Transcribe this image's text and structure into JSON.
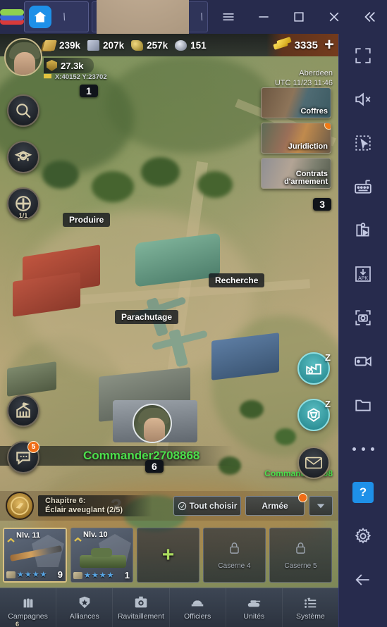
{
  "window": {
    "logo": "bluestacks-logo",
    "tabs": [
      {
        "id": "home",
        "icon": "home-icon",
        "close": "\\"
      },
      {
        "id": "game",
        "icon": "game-thumbnail",
        "close": "\\"
      }
    ],
    "controls": {
      "menu": "hamburger-menu-icon",
      "minimize": "minimize-icon",
      "maximize": "maximize-icon",
      "close": "close-icon",
      "collapse": "collapse-icon"
    }
  },
  "game": {
    "resources": [
      {
        "id": "food",
        "icon": "food-icon",
        "value": "239k"
      },
      {
        "id": "steel",
        "icon": "steel-icon",
        "value": "207k"
      },
      {
        "id": "oil",
        "icon": "oil-icon",
        "value": "257k"
      },
      {
        "id": "gem",
        "icon": "gem-icon",
        "value": "151"
      }
    ],
    "gold": {
      "icon": "gold-bars-icon",
      "value": "3335",
      "add": "+"
    },
    "player": {
      "avatar": "player-avatar",
      "level": "6",
      "power_icon": "power-badge-icon",
      "power": "27.3k",
      "flag_icon": "flag-icon",
      "coords": "X:40152 Y:23702"
    },
    "server": {
      "name": "Aberdeen",
      "time": "UTC  11/23 11:46"
    },
    "left_buttons": [
      {
        "id": "search",
        "icon": "search-icon",
        "count": ""
      },
      {
        "id": "rank",
        "icon": "rank-badge-icon",
        "count": ""
      },
      {
        "id": "aircraft",
        "icon": "aircraft-icon",
        "count": "1/1"
      }
    ],
    "left_bottom_buttons": [
      {
        "id": "base",
        "icon": "base-building-icon",
        "badge": ""
      },
      {
        "id": "chat",
        "icon": "chat-bubble-icon",
        "badge": "5"
      }
    ],
    "event_cards": [
      {
        "id": "chests",
        "label": "Coffres",
        "dot": false
      },
      {
        "id": "jurisdiction",
        "label": "Juridiction",
        "dot": true
      },
      {
        "id": "arms_contracts",
        "label": "Contrats\nd'armement",
        "dot": false
      }
    ],
    "event_count_badge": "3",
    "map_markers": [
      {
        "id": "marker-1",
        "value": "1"
      },
      {
        "id": "marker-6",
        "value": "6"
      }
    ],
    "map_labels": [
      {
        "id": "produce",
        "label": "Produire"
      },
      {
        "id": "research",
        "label": "Recherche"
      },
      {
        "id": "parachute",
        "label": "Parachutage"
      }
    ],
    "commander": {
      "name": "Commander2708868",
      "name_secondary": "Commander2708",
      "color": "#4ce04c"
    },
    "right_buttons": [
      {
        "id": "workshop",
        "icon": "factory-gear-icon",
        "badge": "Z"
      },
      {
        "id": "idle",
        "icon": "shield-hex-icon",
        "badge": "Z"
      },
      {
        "id": "mail",
        "icon": "mail-envelope-icon",
        "badge": ""
      }
    ],
    "quest": {
      "medal_icon": "quest-medal-icon",
      "chapter": "Chapitre 6:",
      "title": "Éclair aveuglant (2/5)",
      "choose_all": "Tout choisir",
      "choose_icon": "check-circle-icon",
      "army": "Armée",
      "army_dot": true,
      "caret_icon": "chevron-down-icon"
    },
    "cards": [
      {
        "id": "card-rifle",
        "level": "Nlv. 11",
        "stars": 4,
        "qty": "9",
        "state": "selected",
        "unit": "rifle"
      },
      {
        "id": "card-tank",
        "level": "Nlv. 10",
        "stars": 4,
        "qty": "1",
        "state": "normal",
        "unit": "tank"
      },
      {
        "id": "card-add",
        "level": "",
        "stars": 0,
        "qty": "",
        "state": "empty",
        "unit": "",
        "plus": "+"
      },
      {
        "id": "card-barracks-4",
        "level": "",
        "stars": 0,
        "qty": "",
        "state": "locked",
        "name": "Caserne 4",
        "lock_icon": "lock-icon"
      },
      {
        "id": "card-barracks-5",
        "level": "",
        "stars": 0,
        "qty": "",
        "state": "locked",
        "name": "Caserne 5",
        "lock_icon": "lock-icon"
      }
    ],
    "bottom_nav": [
      {
        "id": "campaigns",
        "label": "Campagnes",
        "icon": "bullets-icon"
      },
      {
        "id": "alliances",
        "label": "Alliances",
        "icon": "shield-star-icon"
      },
      {
        "id": "supplies",
        "label": "Ravitaillement",
        "icon": "supply-crate-icon"
      },
      {
        "id": "officers",
        "label": "Officiers",
        "icon": "officer-cap-icon"
      },
      {
        "id": "units",
        "label": "Unités",
        "icon": "tank-icon"
      },
      {
        "id": "system",
        "label": "Système",
        "icon": "list-icon"
      }
    ]
  },
  "sidebar": {
    "items": [
      {
        "id": "fullscreen",
        "icon": "fullscreen-icon"
      },
      {
        "id": "mute",
        "icon": "mute-icon"
      },
      {
        "id": "multi-select",
        "icon": "cursor-select-icon"
      },
      {
        "id": "keymapping",
        "icon": "keyboard-icon"
      },
      {
        "id": "macro",
        "icon": "macro-play-icon"
      },
      {
        "id": "install-apk",
        "icon": "apk-install-icon",
        "text": "APK"
      },
      {
        "id": "screenshot",
        "icon": "screenshot-icon"
      },
      {
        "id": "record",
        "icon": "video-record-icon"
      },
      {
        "id": "media",
        "icon": "folder-icon"
      },
      {
        "id": "more",
        "icon": "more-dots-icon"
      },
      {
        "id": "help",
        "icon": "help-icon",
        "text": "?"
      },
      {
        "id": "settings",
        "icon": "gear-icon"
      },
      {
        "id": "back",
        "icon": "back-arrow-icon"
      }
    ]
  }
}
